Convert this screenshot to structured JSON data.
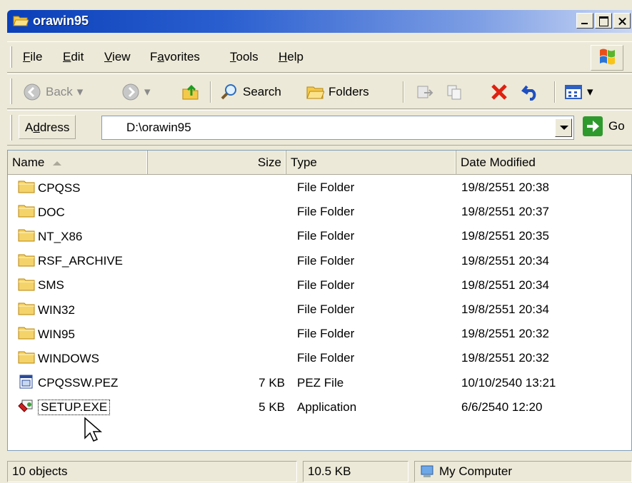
{
  "window": {
    "title": "orawin95",
    "icon": "folder-open-icon"
  },
  "menu": {
    "items": [
      {
        "label": "File",
        "accel": "F",
        "rest": "ile"
      },
      {
        "label": "Edit",
        "accel": "E",
        "rest": "dit"
      },
      {
        "label": "View",
        "accel": "V",
        "rest": "iew"
      },
      {
        "label": "Favorites",
        "pre": "F",
        "accel": "a",
        "rest": "vorites"
      },
      {
        "label": "Tools",
        "accel": "T",
        "rest": "ools"
      },
      {
        "label": "Help",
        "accel": "H",
        "rest": "elp"
      }
    ]
  },
  "toolbar": {
    "back_label": "Back",
    "search_label": "Search",
    "folders_label": "Folders"
  },
  "address": {
    "label_pre": "A",
    "label_accel": "d",
    "label_rest": "dress",
    "value": "D:\\orawin95",
    "go_label": "Go"
  },
  "columns": {
    "name": "Name",
    "size": "Size",
    "type": "Type",
    "date": "Date Modified"
  },
  "files": [
    {
      "name": "CPQSS",
      "size": "",
      "type": "File Folder",
      "date": "19/8/2551 20:38",
      "icon": "folder-icon"
    },
    {
      "name": "DOC",
      "size": "",
      "type": "File Folder",
      "date": "19/8/2551 20:37",
      "icon": "folder-icon"
    },
    {
      "name": "NT_X86",
      "size": "",
      "type": "File Folder",
      "date": "19/8/2551 20:35",
      "icon": "folder-icon"
    },
    {
      "name": "RSF_ARCHIVE",
      "size": "",
      "type": "File Folder",
      "date": "19/8/2551 20:34",
      "icon": "folder-icon"
    },
    {
      "name": "SMS",
      "size": "",
      "type": "File Folder",
      "date": "19/8/2551 20:34",
      "icon": "folder-icon"
    },
    {
      "name": "WIN32",
      "size": "",
      "type": "File Folder",
      "date": "19/8/2551 20:34",
      "icon": "folder-icon"
    },
    {
      "name": "WIN95",
      "size": "",
      "type": "File Folder",
      "date": "19/8/2551 20:32",
      "icon": "folder-icon"
    },
    {
      "name": "WINDOWS",
      "size": "",
      "type": "File Folder",
      "date": "19/8/2551 20:32",
      "icon": "folder-icon"
    },
    {
      "name": "CPQSSW.PEZ",
      "size": "7 KB",
      "type": "PEZ File",
      "date": "10/10/2540 13:21",
      "icon": "pez-file-icon"
    },
    {
      "name": "SETUP.EXE",
      "size": "5 KB",
      "type": "Application",
      "date": "6/6/2540 12:20",
      "icon": "setup-exe-icon"
    }
  ],
  "status": {
    "objects": "10 objects",
    "size": "10.5 KB",
    "location": "My Computer"
  },
  "colors": {
    "title_bar_start": "#0a3fb8",
    "folder": "#f4d36a",
    "face": "#ece9d8"
  }
}
